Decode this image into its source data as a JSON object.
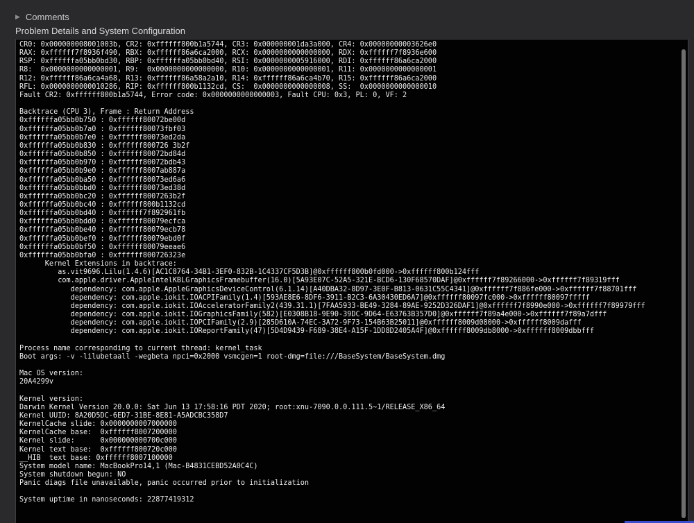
{
  "comments": {
    "label": "Comments"
  },
  "problem_details": {
    "title": "Problem Details and System Configuration",
    "lines": [
      "CR0: 0x000000008001003b, CR2: 0xffffff800b1a5744, CR3: 0x000000001da3a000, CR4: 0x00000000003626e0",
      "RAX: 0xffffff7f8936f490, RBX: 0xffffff86a6ca2000, RCX: 0x0000000000000000, RDX: 0xffffff7f8936e600",
      "RSP: 0xffffffa05bb0bd30, RBP: 0xffffffa05bb0bd40, RSI: 0x0000000005916000, RDI: 0xffffff86a6ca2000",
      "R8:  0x0000000000000001, R9:  0x0000000000000000, R10: 0x0000000000000001, R11: 0x0000000000000001",
      "R12: 0xffffff86a6ca4a68, R13: 0xffffff86a58a2a10, R14: 0xffffff86a6ca4b70, R15: 0xffffff86a6ca2000",
      "RFL: 0x0000000000010286, RIP: 0xffffff800b1132cd, CS:  0x0000000000000008, SS:  0x0000000000000010",
      "Fault CR2: 0xffffff800b1a5744, Error code: 0x0000000000000003, Fault CPU: 0x3, PL: 0, VF: 2",
      "",
      "Backtrace (CPU 3), Frame : Return Address",
      "0xffffffa05bb0b750 : 0xffffff80072be00d",
      "0xffffffa05bb0b7a0 : 0xffffff80073fbf03",
      "0xffffffa05bb0b7e0 : 0xffffff80073ed2da",
      "0xffffffa05bb0b830 : 0xffffff800726 3b2f",
      "0xffffffa05bb0b850 : 0xffffff80072bd84d",
      "0xffffffa05bb0b970 : 0xffffff80072bdb43",
      "0xffffffa05bb0b9e0 : 0xffffff8007ab887a",
      "0xffffffa05bb0ba50 : 0xffffff80073ed6a6",
      "0xffffffa05bb0bbd0 : 0xffffff80073ed38d",
      "0xffffffa05bb0bc20 : 0xffffff8007263b2f",
      "0xffffffa05bb0bc40 : 0xffffff800b1132cd",
      "0xffffffa05bb0bd40 : 0xffffff7f892961fb",
      "0xffffffa05bb0bdd0 : 0xffffff80079ecfca",
      "0xffffffa05bb0be40 : 0xffffff80079ecb78",
      "0xffffffa05bb0bef0 : 0xffffff80079ebd0f",
      "0xffffffa05bb0bf50 : 0xffffff80079eeae6",
      "0xffffffa05bb0bfa0 : 0xffffff800726323e",
      "      Kernel Extensions in backtrace:",
      "         as.vit9696.Lilu(1.4.6)[AC1C8764-34B1-3EF0-832B-1C4337CF5D3B]@0xffffff800b0fd000->0xffffff800b124fff",
      "         com.apple.driver.AppleIntelKBLGraphicsFramebuffer(16.0)[5A93E07C-52A5-321E-BCD6-130F68570DAF]@0xffffff7f89266000->0xffffff7f89319fff",
      "            dependency: com.apple.AppleGraphicsDeviceControl(6.1.14)[A40DBA32-8D97-3E0F-B813-0631C55C4341]@0xffffff7f886fe000->0xffffff7f88701fff",
      "            dependency: com.apple.iokit.IOACPIFamily(1.4)[593AE8E6-8DF6-3911-B2C3-6A30430ED6A7]@0xffffff80097fc000->0xffffff80097fffff",
      "            dependency: com.apple.iokit.IOAcceleratorFamily2(439.31.1)[7FAA5933-BE49-3284-89AE-9252D326DAF1]@0xffffff7f8990e000->0xffffff7f89979fff",
      "            dependency: com.apple.iokit.IOGraphicsFamily(582)[E0308B18-9E90-39DC-9D64-E63763B357D0]@0xffffff7f89a4e000->0xffffff7f89a7dfff",
      "            dependency: com.apple.iokit.IOPCIFamily(2.9)[285D610A-74EC-3A72-9F73-154B63B25011]@0xffffff8009d08000->0xffffff8009dafff",
      "            dependency: com.apple.iokit.IOReportFamily(47)[5D4D9439-F689-38E4-A15F-1DD8D2405A4F]@0xffffff8009db8000->0xffffff8009dbbfff",
      "",
      "Process name corresponding to current thread: kernel_task",
      "Boot args: -v -lilubetaall -wegbeta npci=0x2000 vsmcgen=1 root-dmg=file:///BaseSystem/BaseSystem.dmg",
      "",
      "Mac OS version:",
      "20A4299v",
      "",
      "Kernel version:",
      "Darwin Kernel Version 20.0.0: Sat Jun 13 17:58:16 PDT 2020; root:xnu-7090.0.0.111.5~1/RELEASE_X86_64",
      "Kernel UUID: 8A20D5DC-6ED7-31BE-8E81-A5ADCBC358D7",
      "KernelCache slide: 0x0000000007000000",
      "KernelCache base:  0xffffff8007200000",
      "Kernel slide:      0x000000000700c000",
      "Kernel text base:  0xffffff800720c000",
      "__HIB  text base: 0xffffff8007100000",
      "System model name: MacBookPro14,1 (Mac-B4831CEBD52A0C4C)",
      "System shutdown begun: NO",
      "Panic diags file unavailable, panic occurred prior to initialization",
      "",
      "System uptime in nanoseconds: 22877419312"
    ]
  }
}
